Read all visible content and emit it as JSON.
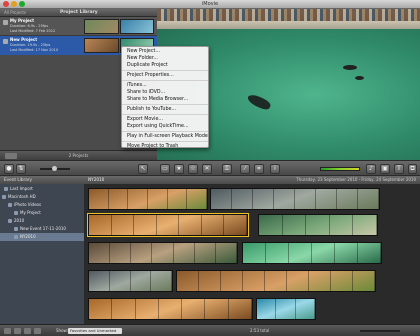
{
  "window": {
    "title": "iMovie"
  },
  "library": {
    "all_projects": "All Projects",
    "title": "Project Library",
    "projects": [
      {
        "name": "My Project",
        "duration": "Duration: 6.9s - 25fps",
        "modified": "Last Modified: 7 Feb 2012"
      },
      {
        "name": "New Project",
        "duration": "Duration: 19.5s - 25fps",
        "modified": "Last Modified: 17 Nov 2010"
      }
    ],
    "count": "2 Projects"
  },
  "context_menu": {
    "items": [
      "New Project...",
      "New Folder...",
      "Duplicate Project",
      "Project Properties...",
      "iTunes...",
      "Share to iDVD...",
      "Share to Media Browser...",
      "Publish to YouTube...",
      "Export Movie...",
      "Export using QuickTime...",
      "Play in Full-screen Playback Mode",
      "Move Project to Trash"
    ]
  },
  "event_library": {
    "title": "Event Library",
    "items": [
      {
        "label": "Last Import",
        "indent": 1
      },
      {
        "label": "Macintosh HD",
        "indent": 0
      },
      {
        "label": "iPhoto Videos",
        "indent": 1
      },
      {
        "label": "My Project",
        "indent": 2
      },
      {
        "label": "2010",
        "indent": 1
      },
      {
        "label": "New Event 17-11-2010",
        "indent": 2
      },
      {
        "label": "NY2010",
        "indent": 2
      }
    ],
    "selected_index": 6
  },
  "event_browser": {
    "title": "NY2010",
    "date": "Thursday, 23 September 2010 - Friday, 24 September 2010"
  },
  "bottom": {
    "show_label": "Show:",
    "show_value": "Favorites and Unmarked",
    "total": "2:53 total"
  },
  "toolbar": {
    "undo_icon": "arrow-icon",
    "star_icon": "star-icon",
    "reject_icon": "x-icon",
    "keyword_icon": "key-icon",
    "enhance_icon": "wand-icon",
    "crop_icon": "crop-icon",
    "info_icon": "info-icon"
  }
}
